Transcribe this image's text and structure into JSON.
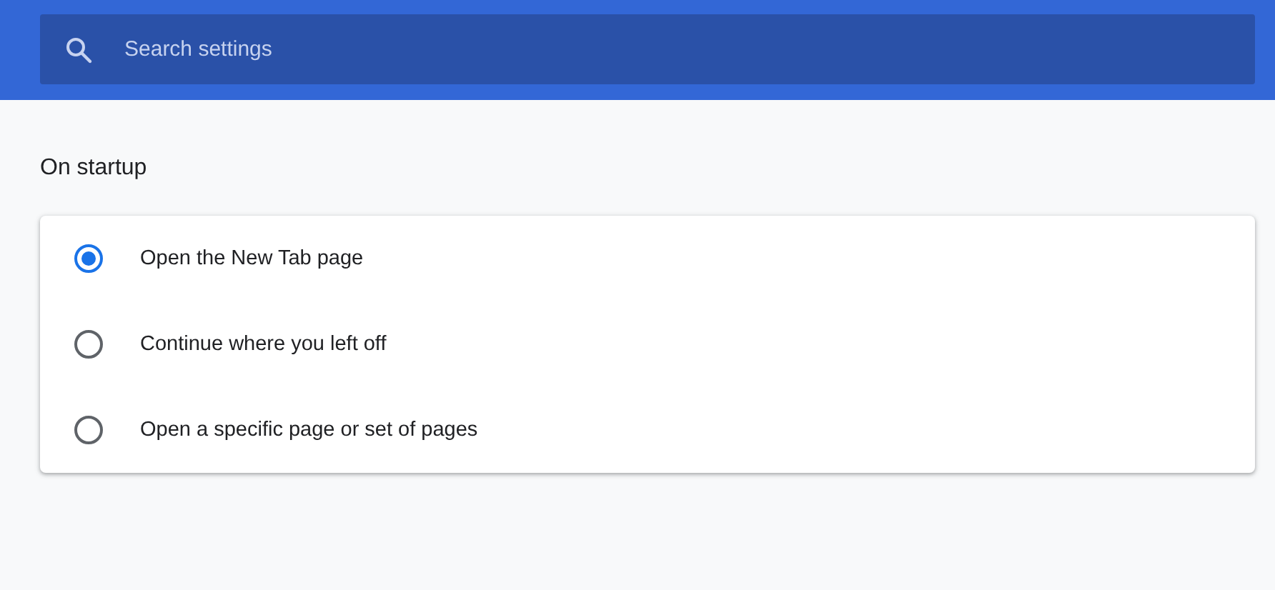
{
  "search": {
    "placeholder": "Search settings"
  },
  "section_title": "On startup",
  "options": [
    {
      "label": "Open the New Tab page",
      "selected": true
    },
    {
      "label": "Continue where you left off",
      "selected": false
    },
    {
      "label": "Open a specific page or set of pages",
      "selected": false
    }
  ]
}
